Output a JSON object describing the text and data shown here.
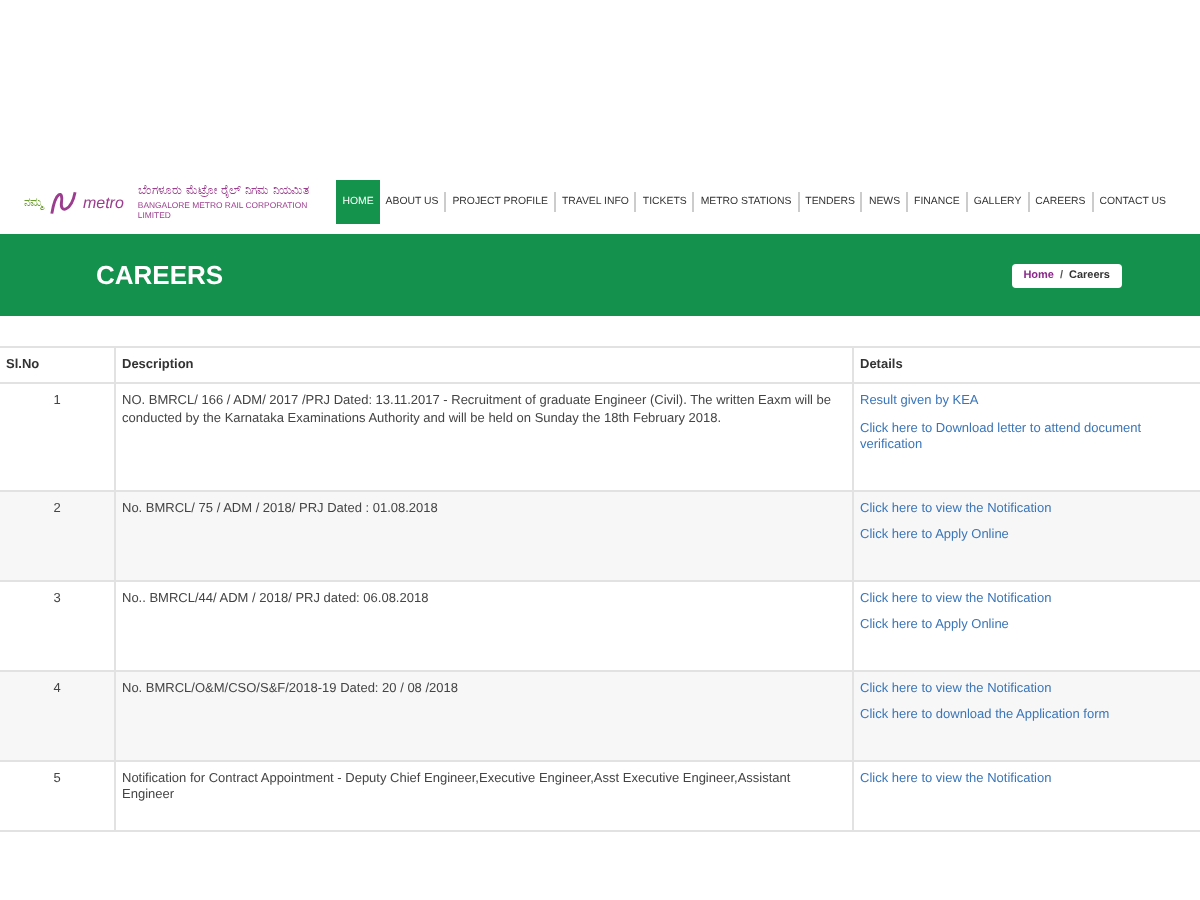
{
  "logo": {
    "namma": "ನಮ್ಮ",
    "metro": "metro",
    "name_kannada": "ಬೆಂಗಳೂರು ಮೆಟ್ರೋ ರೈಲ್ ನಿಗಮ ನಿಯಮಿತ",
    "name_english": "BANGALORE METRO RAIL CORPORATION LIMITED"
  },
  "nav": [
    {
      "label": "HOME",
      "selected": true
    },
    {
      "label": "ABOUT US",
      "selected": false
    },
    {
      "label": "PROJECT PROFILE",
      "selected": false
    },
    {
      "label": "TRAVEL INFO",
      "selected": false
    },
    {
      "label": "TICKETS",
      "selected": false
    },
    {
      "label": "METRO STATIONS",
      "selected": false
    },
    {
      "label": "TENDERS",
      "selected": false
    },
    {
      "label": "NEWS",
      "selected": false
    },
    {
      "label": "FINANCE",
      "selected": false
    },
    {
      "label": "GALLERY",
      "selected": false
    },
    {
      "label": "CAREERS",
      "selected": false
    },
    {
      "label": "CONTACT US",
      "selected": false
    }
  ],
  "banner": {
    "title": "CAREERS",
    "breadcrumb": [
      "Home",
      "Careers"
    ],
    "separator": "/"
  },
  "table": {
    "columns": [
      "Sl.No",
      "Description",
      "Details"
    ],
    "rows": [
      {
        "no": "1",
        "description": "NO. BMRCL/ 166 / ADM/ 2017 /PRJ Dated: 13.11.2017 - Recruitment of graduate Engineer (Civil). The written Eaxm will be conducted by the Karnataka Examinations Authority and will be held on Sunday the 18th February 2018.",
        "links": [
          "Result given by KEA",
          "Click here to Download letter to attend document verification"
        ]
      },
      {
        "no": "2",
        "description": "No. BMRCL/ 75 / ADM / 2018/ PRJ Dated : 01.08.2018",
        "links": [
          "Click here to view the Notification",
          "Click here to Apply Online"
        ]
      },
      {
        "no": "3",
        "description": "No.. BMRCL/44/ ADM / 2018/ PRJ dated: 06.08.2018",
        "links": [
          "Click here to view the Notification",
          "Click here to Apply Online"
        ]
      },
      {
        "no": "4",
        "description": "No. BMRCL/O&M/CSO/S&F/2018-19 Dated: 20 / 08 /2018",
        "links": [
          "Click here to view the Notification",
          "Click here to download the Application form"
        ]
      },
      {
        "no": "5",
        "description": "Notification for Contract Appointment - Deputy Chief Engineer,Executive Engineer,Asst Executive Engineer,Assistant Engineer",
        "links": [
          "Click here to view the Notification"
        ]
      }
    ]
  }
}
